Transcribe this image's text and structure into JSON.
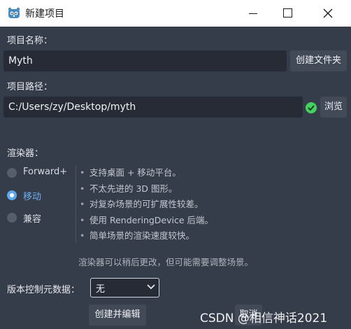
{
  "window": {
    "title": "新建项目",
    "icon": "godot-engine-icon",
    "controls": [
      "minimize-icon",
      "maximize-icon",
      "close-icon"
    ]
  },
  "project_name": {
    "label": "项目名称：",
    "value": "Myth",
    "create_folder_label": "创建文件夹"
  },
  "project_path": {
    "label": "项目路径：",
    "value": "C:/Users/zy/Desktop/myth",
    "status_icon": "check-circle-icon",
    "browse_label": "浏览"
  },
  "renderer": {
    "label": "渲染器：",
    "options": [
      {
        "label": "Forward+",
        "selected": false
      },
      {
        "label": "移动",
        "selected": true
      },
      {
        "label": "兼容",
        "selected": false
      }
    ],
    "description": [
      "支持桌面 + 移动平台。",
      "不太先进的 3D 图形。",
      "对复杂场景的可扩展性较差。",
      "使用 RenderingDevice 后端。",
      "简单场景的渲染速度较快。"
    ],
    "bullet": "•",
    "note": "渲染器可以稍后更改，但可能需要调整场景。"
  },
  "vcs": {
    "label": "版本控制元数据：",
    "selected": "无"
  },
  "actions": {
    "create_edit_label": "创建并编辑",
    "cancel_label": "取消"
  },
  "watermark": "CSDN @相信神话2021",
  "colors": {
    "background": "#363d4a",
    "accent": "#5fa8ee",
    "success": "#45d15e",
    "input_bg": "#262b35"
  }
}
